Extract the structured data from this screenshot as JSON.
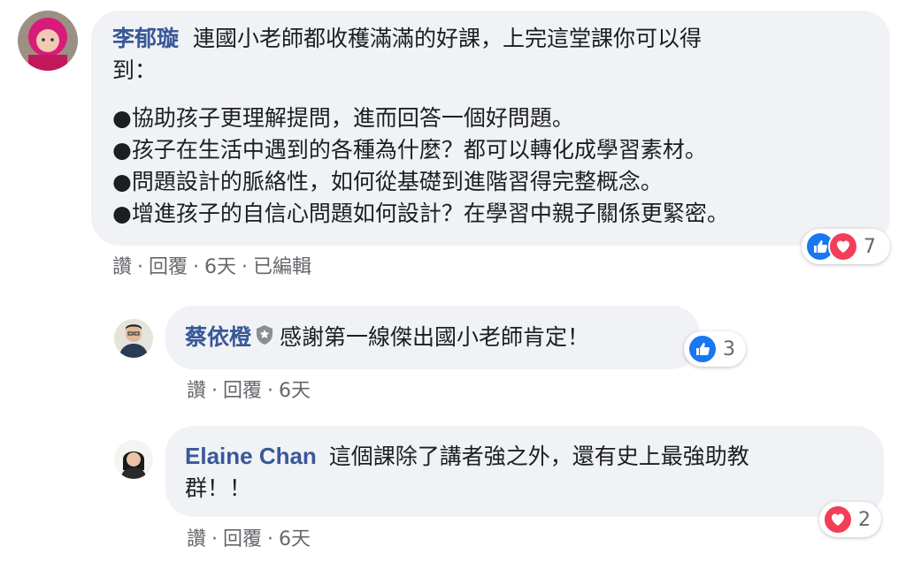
{
  "comments": [
    {
      "author": "李郁璇",
      "text_line1": "連國小老師都收穫滿滿的好課，上完這堂課你可以得",
      "text_line2": "到：",
      "bullets": [
        "●協助孩子更理解提問，進而回答一個好問題。",
        "●孩子在生活中遇到的各種為什麼？都可以轉化成學習素材。",
        "●問題設計的脈絡性，如何從基礎到進階習得完整概念。",
        "●增進孩子的自信心問題如何設計？在學習中親子關係更緊密。"
      ],
      "actions": {
        "like": "讚",
        "reply": "回覆",
        "time": "6天",
        "edited": "已編輯",
        "dot": "·"
      },
      "reactions": {
        "types": [
          "like",
          "love"
        ],
        "count": "7"
      }
    },
    {
      "author": "蔡依橙",
      "text": "感謝第一線傑出國小老師肯定！",
      "actions": {
        "like": "讚",
        "reply": "回覆",
        "time": "6天",
        "dot": "·"
      },
      "reactions": {
        "types": [
          "like"
        ],
        "count": "3"
      }
    },
    {
      "author": "Elaine Chan",
      "text_line1": "這個課除了講者強之外，還有史上最強助教",
      "text_line2": "群！！",
      "actions": {
        "like": "讚",
        "reply": "回覆",
        "time": "6天",
        "dot": "·"
      },
      "reactions": {
        "types": [
          "love"
        ],
        "count": "2"
      }
    }
  ],
  "colors": {
    "author": "#385898",
    "bubble": "#f0f2f5",
    "like": "#1877f2",
    "love": "#f33e58",
    "meta": "#65676b"
  }
}
